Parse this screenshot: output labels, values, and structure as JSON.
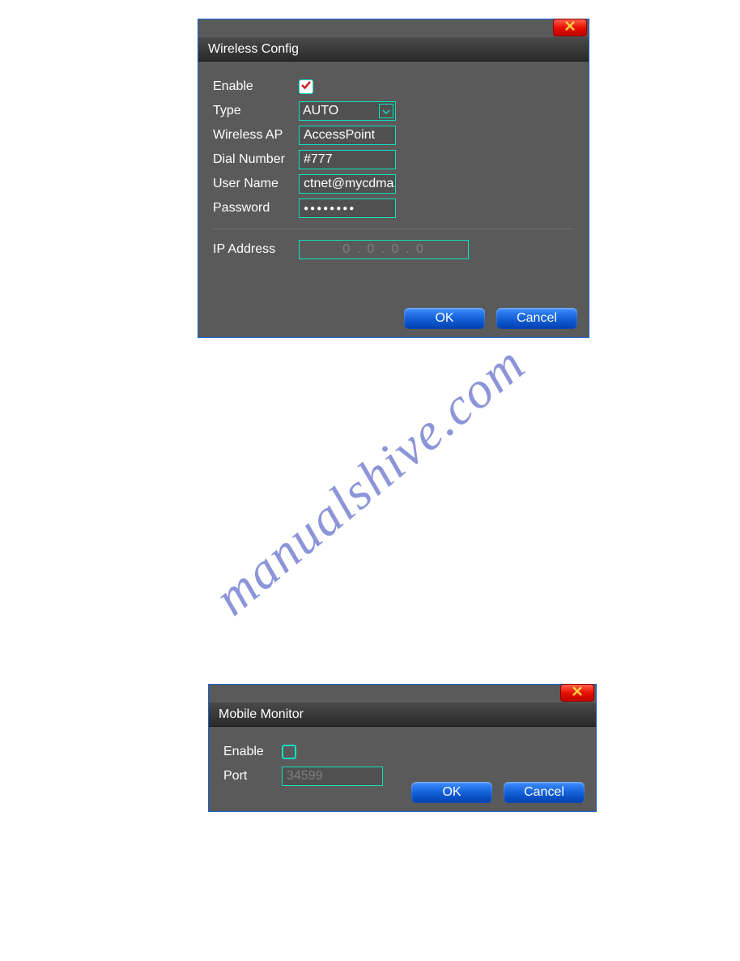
{
  "watermark": "manualshive.com",
  "dialog1": {
    "title": "Wireless Config",
    "enable_label": "Enable",
    "enable_checked": true,
    "type_label": "Type",
    "type_value": "AUTO",
    "wireless_ap_label": "Wireless AP",
    "wireless_ap_value": "AccessPoint",
    "dial_number_label": "Dial Number",
    "dial_number_value": "#777",
    "user_name_label": "User Name",
    "user_name_value": "ctnet@mycdma.",
    "password_label": "Password",
    "password_value": "●●●●●●●●",
    "ip_address_label": "IP Address",
    "ip_address_value": "0   .   0   .   0   .   0",
    "ok_label": "OK",
    "cancel_label": "Cancel"
  },
  "dialog2": {
    "title": "Mobile Monitor",
    "enable_label": "Enable",
    "enable_checked": false,
    "port_label": "Port",
    "port_value": "34599",
    "ok_label": "OK",
    "cancel_label": "Cancel"
  }
}
